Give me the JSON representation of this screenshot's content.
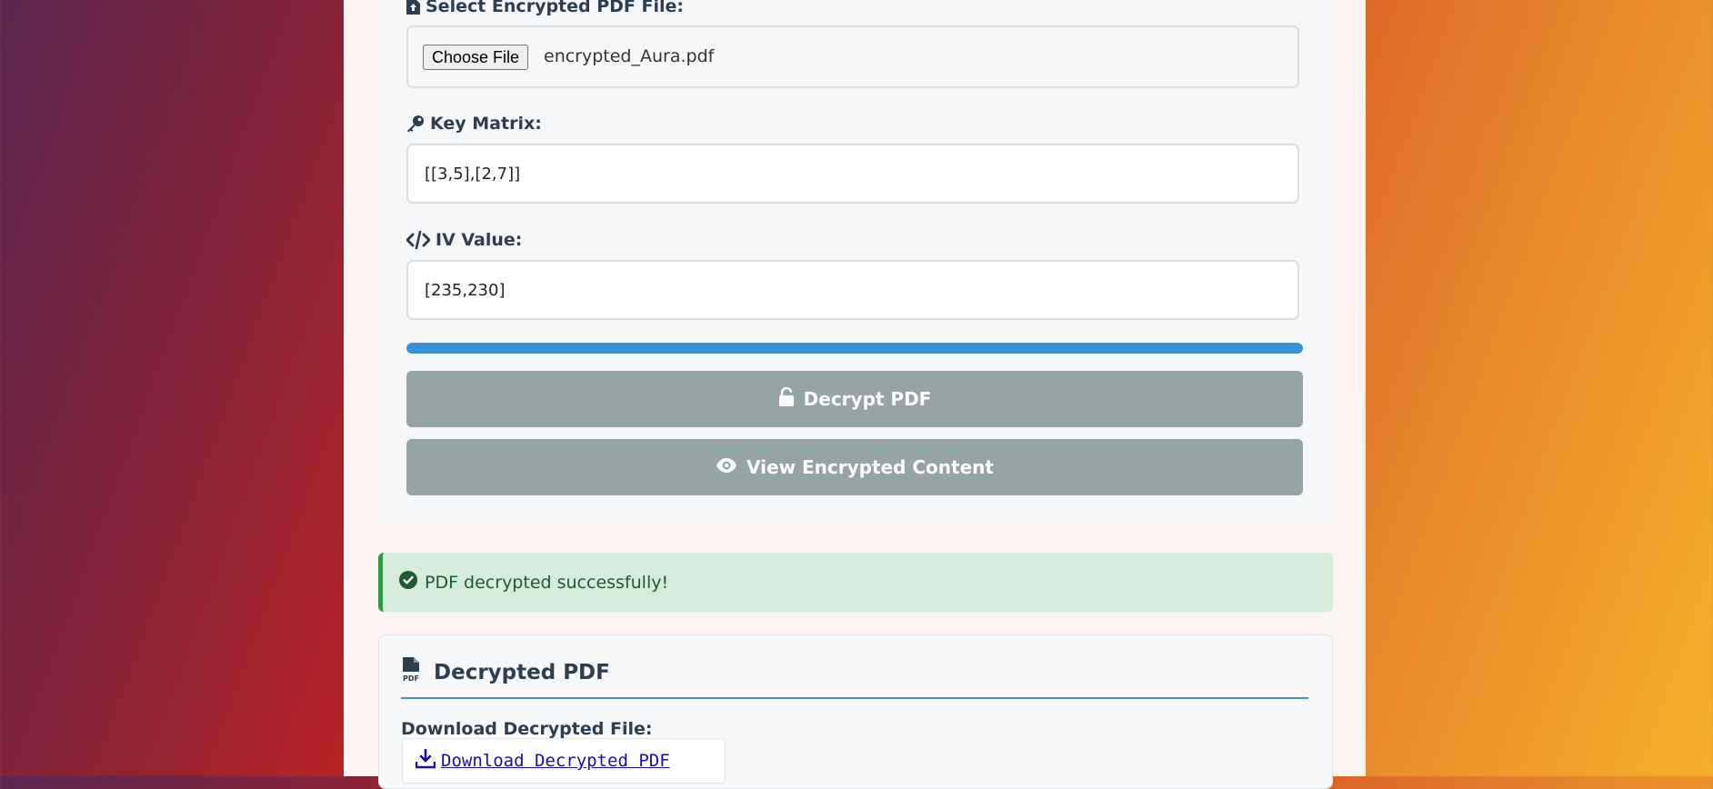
{
  "colors": {
    "accent": "#3892d6",
    "button_disabled": "#95a5a6",
    "success_bg": "#d4ecd9",
    "success_border": "#2c9a45",
    "heading_text": "#2c3e50"
  },
  "form": {
    "file_label": "Select Encrypted PDF File:",
    "file_label_icon": "file-upload-icon",
    "choose_file_label": "Choose File",
    "file_name": "encrypted_Aura.pdf",
    "key_label": "Key Matrix:",
    "key_label_icon": "key-icon",
    "key_value": "[[3,5],[2,7]]",
    "iv_label": "IV Value:",
    "iv_label_icon": "code-icon",
    "iv_value": "[235,230]",
    "progress": 1.0,
    "decrypt_button": "Decrypt PDF",
    "decrypt_icon": "unlock-icon",
    "view_button": "View Encrypted Content",
    "view_icon": "eye-icon"
  },
  "alert": {
    "icon": "check-circle-icon",
    "message": "PDF decrypted successfully!"
  },
  "result": {
    "title": "Decrypted PDF",
    "title_icon": "pdf-file-icon",
    "download_label": "Download Decrypted File:",
    "download_link": " Download Decrypted PDF",
    "download_icon": "download-icon"
  }
}
